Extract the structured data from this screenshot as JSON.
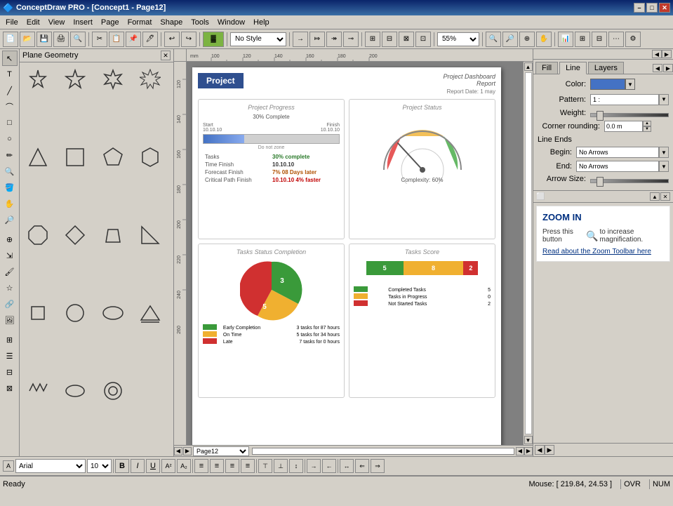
{
  "titlebar": {
    "text": "ConceptDraw PRO - [Concept1 - Page12]",
    "min": "–",
    "max": "□",
    "close": "✕"
  },
  "menubar": {
    "items": [
      "File",
      "Edit",
      "View",
      "Insert",
      "Page",
      "Format",
      "Shape",
      "Tools",
      "Window",
      "Help"
    ]
  },
  "toolbar": {
    "style_dropdown": "No Style",
    "zoom_dropdown": "55%"
  },
  "shape_panel": {
    "title": "Plane Geometry"
  },
  "canvas": {
    "page_header": "Project",
    "dashboard_title": "Project Dashboard",
    "dashboard_subtitle": "Report",
    "report_date_label": "Report Date:",
    "report_date_value": "1 may",
    "section1_title": "Project Progress",
    "progress_percent": "30% Complete",
    "start_label": "Start",
    "start_date": "10.10.10",
    "finish_label": "Finish",
    "finish_date": "10.10.10",
    "do_not_zone": "Do not zone",
    "tasks_label": "Tasks",
    "tasks_value": "30% complete",
    "time_finish_label": "Time Finish",
    "time_finish_value": "10.10.10",
    "forecast_finish_label": "Forecast Finish",
    "forecast_finish_value": "7% 08 Days later",
    "critical_path_label": "Critical Path Finish",
    "critical_path_value": "10.10.10  4% faster",
    "section2_title": "Project Status",
    "complexity_label": "Complexity:",
    "complexity_value": "60%",
    "section3_title": "Tasks Status Completion",
    "early_label": "Early Completion",
    "early_value": "3 tasks for 87 hours",
    "on_time_label": "On Time",
    "on_time_value": "5 tasks for 34 hours",
    "late_label": "Late",
    "late_value": "7 tasks for 0 hours",
    "section4_title": "Tasks Score",
    "completed_tasks_label": "Completed Tasks",
    "completed_tasks_value": "5",
    "in_progress_label": "Tasks in Progress",
    "in_progress_value": "0",
    "not_started_label": "Not Started Tasks",
    "not_started_value": "2"
  },
  "right_panel": {
    "tab_fill": "Fill",
    "tab_line": "Line",
    "tab_layers": "Layers",
    "color_label": "Color:",
    "pattern_label": "Pattern:",
    "pattern_value": "1 :",
    "weight_label": "Weight:",
    "corner_label": "Corner rounding:",
    "corner_value": "0.0 m",
    "line_ends_label": "Line Ends",
    "begin_label": "Begin:",
    "begin_value": "No Arrows",
    "end_label": "End:",
    "end_value": "No Arrows",
    "arrow_size_label": "Arrow Size:"
  },
  "zoom_panel": {
    "title": "ZOOM IN",
    "description": "Press this button",
    "description2": "to increase magnification.",
    "link_text": "Read about the Zoom Toolbar here"
  },
  "format_bar": {
    "font_name": "Arial",
    "font_size": "10"
  },
  "statusbar": {
    "ready": "Ready",
    "mouse_label": "Mouse: [ 219.84, 24.53 ]",
    "ovr": "OVR",
    "num": "NUM"
  },
  "page_selector": {
    "value": "Page12"
  }
}
